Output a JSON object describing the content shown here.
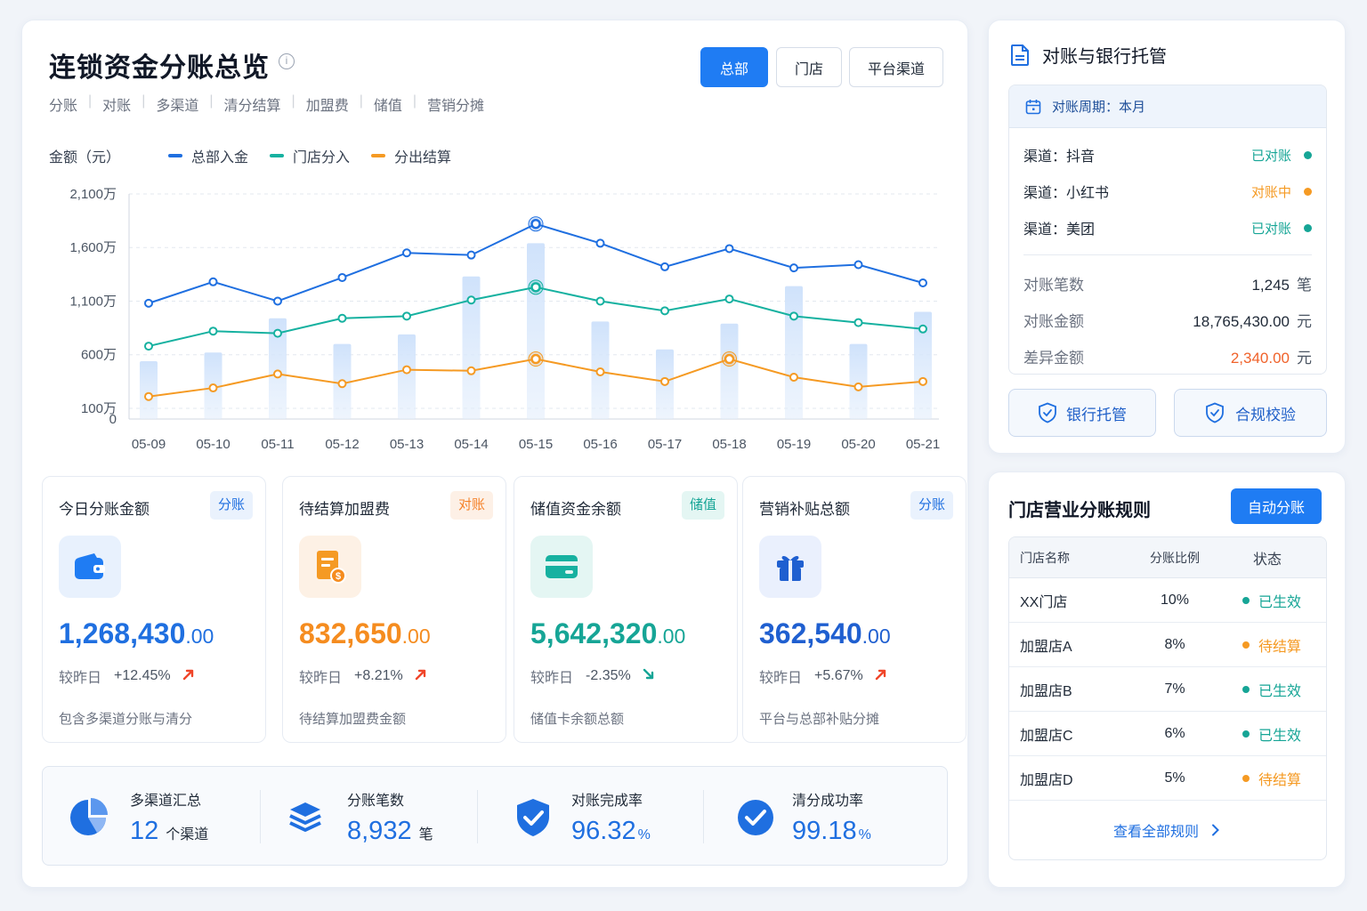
{
  "header": {
    "title": "连锁资金分账总览",
    "tabs": [
      "分账",
      "对账",
      "多渠道",
      "清分结算",
      "加盟费",
      "储值",
      "营销分摊"
    ],
    "segments": [
      "总部",
      "门店",
      "平台渠道"
    ],
    "active_segment": "总部"
  },
  "chart_data": {
    "type": "line",
    "ylabel": "金额（元）",
    "x": [
      "05-09",
      "05-10",
      "05-11",
      "05-12",
      "05-13",
      "05-14",
      "05-15",
      "05-16",
      "05-17",
      "05-18",
      "05-19",
      "05-20",
      "05-21"
    ],
    "yticks": [
      "0",
      "100万",
      "600万",
      "1,100万",
      "1,600万",
      "2,100万"
    ],
    "yticks_values": [
      0,
      100,
      600,
      1100,
      1600,
      2100
    ],
    "ylim": [
      0,
      2100
    ],
    "unit": "万",
    "series": [
      {
        "name": "总部入金",
        "color": "#1f6fe0",
        "values": [
          1080,
          1280,
          1100,
          1320,
          1550,
          1530,
          1820,
          1640,
          1420,
          1590,
          1410,
          1440,
          1270
        ]
      },
      {
        "name": "门店分入",
        "color": "#16b1a0",
        "values": [
          680,
          820,
          800,
          940,
          960,
          1110,
          1230,
          1100,
          1010,
          1120,
          960,
          900,
          840
        ]
      },
      {
        "name": "分出结算",
        "color": "#f59a23",
        "values": [
          210,
          290,
          420,
          330,
          460,
          450,
          560,
          440,
          350,
          560,
          390,
          300,
          350
        ]
      }
    ],
    "bars": {
      "color": "#cfe2fb",
      "values": [
        540,
        620,
        940,
        700,
        790,
        1330,
        1640,
        910,
        650,
        890,
        1240,
        700,
        1000
      ]
    },
    "highlight_x": [
      "05-15",
      "05-18"
    ],
    "grid": true,
    "legend": "top-left"
  },
  "kpis": [
    {
      "title": "今日分账金额",
      "tag": "分账",
      "value": "1,268,430",
      "decimals": ".00",
      "label": "较昨日",
      "change": "+12.45%",
      "trend": "up",
      "desc": "包含多渠道分账与清分",
      "color": "#1f6fe0",
      "tag_color": "#1f6fe0",
      "tag_bg": "#eaf2fd",
      "icon": "wallet-icon",
      "icon_bg": "#e8f1fd"
    },
    {
      "title": "待结算加盟费",
      "tag": "对账",
      "value": "832,650",
      "decimals": ".00",
      "label": "较昨日",
      "change": "+8.21%",
      "trend": "up",
      "desc": "待结算加盟费金额",
      "color": "#f58c1f",
      "tag_color": "#f5822a",
      "tag_bg": "#fdf0e6",
      "icon": "invoice-icon",
      "icon_bg": "#fdf1e5"
    },
    {
      "title": "储值资金余额",
      "tag": "储值",
      "value": "5,642,320",
      "decimals": ".00",
      "label": "较昨日",
      "change": "-2.35%",
      "trend": "down",
      "desc": "储值卡余额总额",
      "color": "#16a596",
      "tag_color": "#16a596",
      "tag_bg": "#e4f6f3",
      "icon": "card-icon",
      "icon_bg": "#e4f6f3"
    },
    {
      "title": "营销补贴总额",
      "tag": "分账",
      "value": "362,540",
      "decimals": ".00",
      "label": "较昨日",
      "change": "+5.67%",
      "trend": "up",
      "desc": "平台与总部补贴分摊",
      "color": "#1f5fd0",
      "tag_color": "#1f6fe0",
      "tag_bg": "#eaf2fd",
      "icon": "gift-icon",
      "icon_bg": "#eaf0fd"
    }
  ],
  "summary": [
    {
      "label": "多渠道汇总",
      "value": "12",
      "unit": "个渠道",
      "icon": "pie-chart-icon"
    },
    {
      "label": "分账笔数",
      "value": "8,932",
      "unit": "笔",
      "icon": "layers-icon"
    },
    {
      "label": "对账完成率",
      "value": "96.32",
      "unit": "%",
      "icon": "shield-check-icon"
    },
    {
      "label": "清分成功率",
      "value": "99.18",
      "unit": "%",
      "icon": "check-circle-icon"
    }
  ],
  "reconciliation": {
    "title": "对账与银行托管",
    "period": "对账周期：本月",
    "channels": [
      {
        "name": "渠道：抖音",
        "status": "已对账",
        "color": "#16a596"
      },
      {
        "name": "渠道：小红书",
        "status": "对账中",
        "color": "#f59a23"
      },
      {
        "name": "渠道：美团",
        "status": "已对账",
        "color": "#16a596"
      }
    ],
    "details": [
      {
        "label": "对账笔数",
        "value": "1,245",
        "unit": "笔",
        "color": "#1f2937"
      },
      {
        "label": "对账金额",
        "value": "18,765,430.00",
        "unit": "元",
        "color": "#1f2937"
      },
      {
        "label": "差异金额",
        "value": "2,340.00",
        "unit": "元",
        "color": "#f0622a"
      }
    ],
    "buttons": [
      "银行托管",
      "合规校验"
    ]
  },
  "rules": {
    "title": "门店营业分账规则",
    "auto_button": "自动分账",
    "columns": [
      "门店名称",
      "分账比例",
      "状态"
    ],
    "rows": [
      {
        "name": "XX门店",
        "ratio": "10%",
        "status": "已生效",
        "color": "#16a596"
      },
      {
        "name": "加盟店A",
        "ratio": "8%",
        "status": "待结算",
        "color": "#f59a23"
      },
      {
        "name": "加盟店B",
        "ratio": "7%",
        "status": "已生效",
        "color": "#16a596"
      },
      {
        "name": "加盟店C",
        "ratio": "6%",
        "status": "已生效",
        "color": "#16a596"
      },
      {
        "name": "加盟店D",
        "ratio": "5%",
        "status": "待结算",
        "color": "#f59a23"
      }
    ],
    "footer_link": "查看全部规则"
  }
}
